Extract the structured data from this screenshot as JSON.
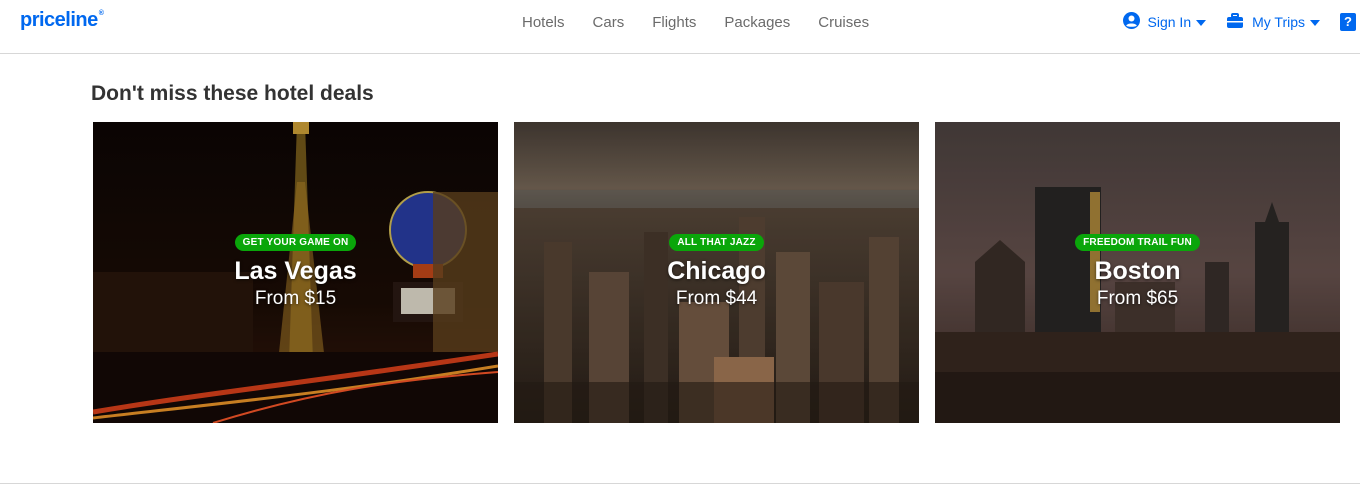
{
  "header": {
    "logo": "priceline",
    "logo_mark": "®",
    "nav": [
      "Hotels",
      "Cars",
      "Flights",
      "Packages",
      "Cruises"
    ],
    "sign_in": "Sign In",
    "my_trips": "My Trips",
    "help_glyph": "?"
  },
  "deals": {
    "title": "Don't miss these hotel deals",
    "cards": [
      {
        "badge": "GET YOUR GAME ON",
        "city": "Las Vegas",
        "price": "From $15"
      },
      {
        "badge": "ALL THAT JAZZ",
        "city": "Chicago",
        "price": "From $44"
      },
      {
        "badge": "FREEDOM TRAIL FUN",
        "city": "Boston",
        "price": "From $65"
      }
    ]
  },
  "colors": {
    "brand": "#0068ef",
    "badge": "#0aa60a"
  },
  "icons": [
    "user-icon",
    "briefcase-icon",
    "help-icon",
    "caret-down-icon"
  ]
}
